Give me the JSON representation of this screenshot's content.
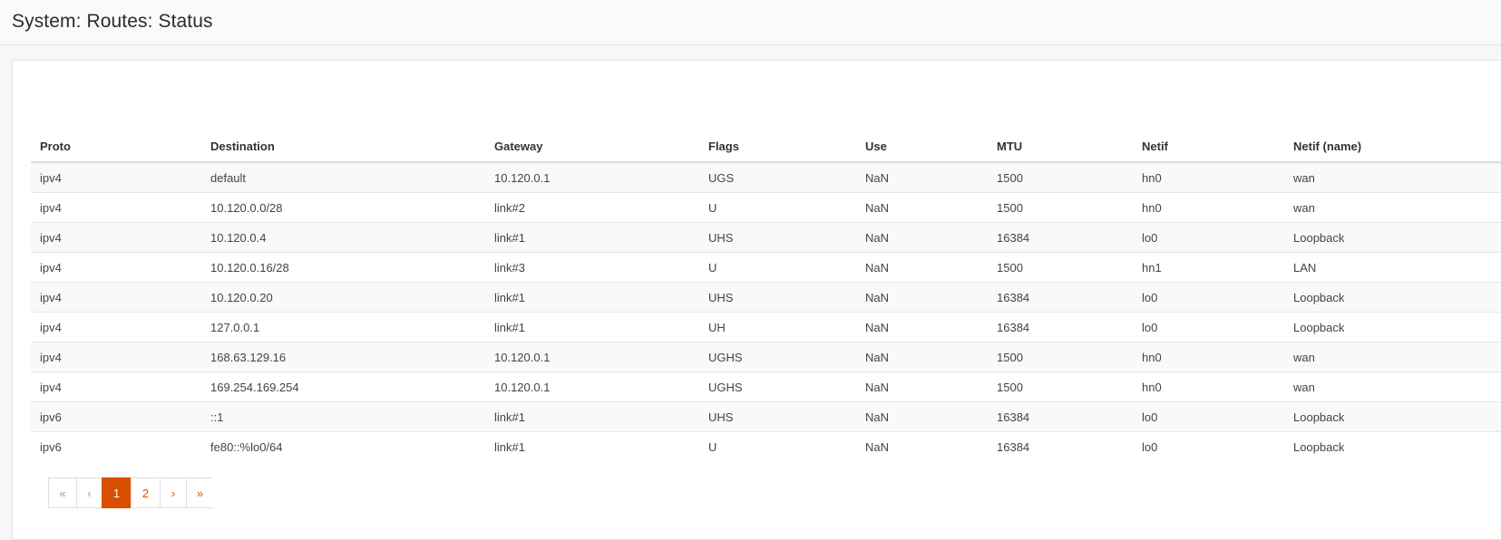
{
  "header": {
    "title": "System: Routes: Status"
  },
  "table": {
    "columns": [
      "Proto",
      "Destination",
      "Gateway",
      "Flags",
      "Use",
      "MTU",
      "Netif",
      "Netif (name)"
    ],
    "rows": [
      [
        "ipv4",
        "default",
        "10.120.0.1",
        "UGS",
        "NaN",
        "1500",
        "hn0",
        "wan"
      ],
      [
        "ipv4",
        "10.120.0.0/28",
        "link#2",
        "U",
        "NaN",
        "1500",
        "hn0",
        "wan"
      ],
      [
        "ipv4",
        "10.120.0.4",
        "link#1",
        "UHS",
        "NaN",
        "16384",
        "lo0",
        "Loopback"
      ],
      [
        "ipv4",
        "10.120.0.16/28",
        "link#3",
        "U",
        "NaN",
        "1500",
        "hn1",
        "LAN"
      ],
      [
        "ipv4",
        "10.120.0.20",
        "link#1",
        "UHS",
        "NaN",
        "16384",
        "lo0",
        "Loopback"
      ],
      [
        "ipv4",
        "127.0.0.1",
        "link#1",
        "UH",
        "NaN",
        "16384",
        "lo0",
        "Loopback"
      ],
      [
        "ipv4",
        "168.63.129.16",
        "10.120.0.1",
        "UGHS",
        "NaN",
        "1500",
        "hn0",
        "wan"
      ],
      [
        "ipv4",
        "169.254.169.254",
        "10.120.0.1",
        "UGHS",
        "NaN",
        "1500",
        "hn0",
        "wan"
      ],
      [
        "ipv6",
        "::1",
        "link#1",
        "UHS",
        "NaN",
        "16384",
        "lo0",
        "Loopback"
      ],
      [
        "ipv6",
        "fe80::%lo0/64",
        "link#1",
        "U",
        "NaN",
        "16384",
        "lo0",
        "Loopback"
      ]
    ]
  },
  "pagination": {
    "first": "«",
    "prev": "‹",
    "pages": [
      "1",
      "2"
    ],
    "current_page": "1",
    "next": "›",
    "last": "»"
  },
  "colors": {
    "accent": "#d94f00",
    "header_bg": "#fafafa",
    "panel_bg": "#ffffff",
    "stripe": "#f9f9f9"
  }
}
